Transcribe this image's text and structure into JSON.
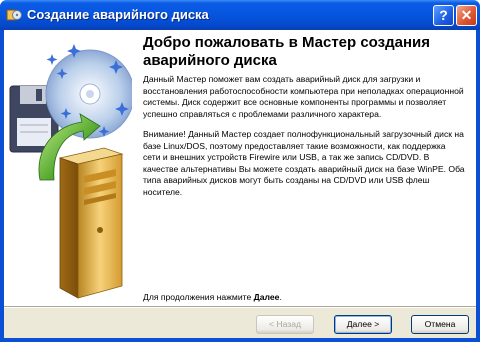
{
  "window": {
    "title": "Создание аварийного диска"
  },
  "title_buttons": {
    "help_label": "?",
    "close_label": "✕"
  },
  "content": {
    "heading": "Добро пожаловать в Мастер создания аварийного диска",
    "paragraph1": "Данный Мастер поможет вам создать аварийный диск для загрузки и восстановления работоспособности компьютера при неполадках операционной системы. Диск содержит все основные компоненты программы и позволяет успешно справляться с проблемами различного характера.",
    "paragraph2": "Внимание! Данный Мастер создает полнофункциональный загрузочный диск на базе Linux/DOS, поэтому предоставляет такие возможности, как поддержка сети и внешних устройств Firewire или USB, а так же запись CD/DVD. В качестве альтернативы Вы можете создать аварийный диск на базе WinPE. Оба типа аварийных дисков могут быть созданы на CD/DVD или USB флеш носителе.",
    "continue_prefix": "Для продолжения нажмите ",
    "continue_bold": "Далее",
    "continue_suffix": "."
  },
  "buttons": {
    "back": "< Назад",
    "next": "Далее >",
    "cancel": "Отмена"
  },
  "icons": {
    "window_icon": "app-icon",
    "illustration": "floppy-cd-computer-illustration"
  },
  "colors": {
    "titlebar": "#0655de",
    "bottombar": "#ece9d8"
  }
}
